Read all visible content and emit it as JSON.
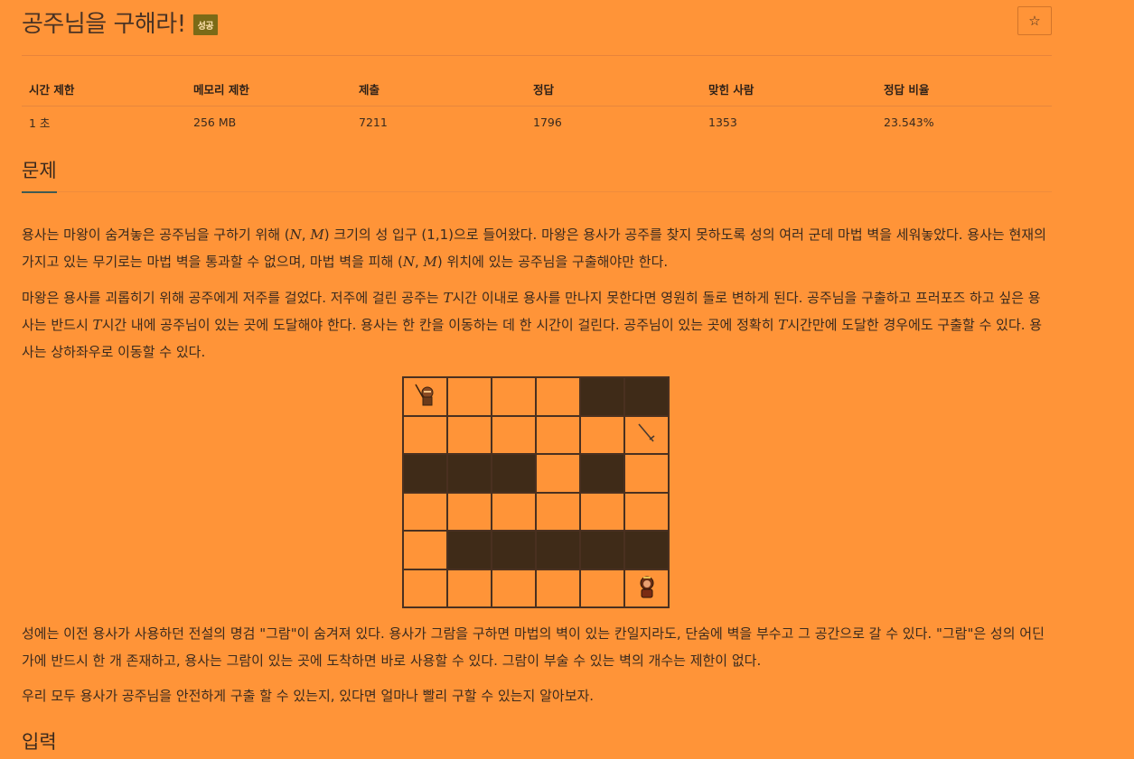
{
  "header": {
    "title": "공주님을 구해라!",
    "badge": "성공",
    "star_icon": "☆"
  },
  "stats": {
    "headers": [
      "시간 제한",
      "메모리 제한",
      "제출",
      "정답",
      "맞힌 사람",
      "정답 비율"
    ],
    "values": [
      "1 초",
      "256 MB",
      "7211",
      "1796",
      "1353",
      "23.543%"
    ]
  },
  "section": {
    "problem_title": "문제",
    "input_title": "입력"
  },
  "text": {
    "p1_a": "용사는 마왕이 숨겨놓은 공주님을 구하기 위해 (",
    "p1_n": "N",
    "p1_sep": ", ",
    "p1_m": "M",
    "p1_b": ") 크기의 성 입구 (1,1)으로 들어왔다. 마왕은 용사가 공주를 찾지 못하도록 성의 여러 군데 마법 벽을 세워놓았다. 용사는 현재의 가지고 있는 무기로는 마법 벽을 통과할 수 없으며, 마법 벽을 피해 (",
    "p1_n2": "N",
    "p1_sep2": ", ",
    "p1_m2": "M",
    "p1_c": ") 위치에 있는 공주님을 구출해야만 한다.",
    "p2_a": "마왕은 용사를 괴롭히기 위해 공주에게 저주를 걸었다. 저주에 걸린 공주는 ",
    "p2_t": "T",
    "p2_b": "시간 이내로 용사를 만나지 못한다면 영원히 돌로 변하게 된다. 공주님을 구출하고 프러포즈 하고 싶은 용사는 반드시 ",
    "p2_t2": "T",
    "p2_c": "시간 내에 공주님이 있는 곳에 도달해야 한다. 용사는 한 칸을 이동하는 데 한 시간이 걸린다. 공주님이 있는 곳에 정확히 ",
    "p2_t3": "T",
    "p2_d": "시간만에 도달한 경우에도 구출할 수 있다. 용사는 상하좌우로 이동할 수 있다.",
    "p4": "성에는 이전 용사가 사용하던 전설의 명검 \"그람\"이 숨겨져 있다. 용사가 그람을 구하면 마법의 벽이 있는 칸일지라도, 단숨에 벽을 부수고 그 공간으로 갈 수 있다. \"그람\"은 성의 어딘가에 반드시 한 개 존재하고, 용사는 그람이 있는 곳에 도착하면 바로 사용할 수 있다. 그람이 부술 수 있는 벽의 개수는 제한이 없다.",
    "p5": "우리 모두 용사가 공주님을 안전하게 구출 할 수 있는지, 있다면 얼마나 빨리 구할 수 있는지 알아보자."
  },
  "grid": {
    "rows": [
      [
        "hero",
        "empty",
        "empty",
        "empty",
        "wall",
        "wall"
      ],
      [
        "empty",
        "empty",
        "empty",
        "empty",
        "empty",
        "sword"
      ],
      [
        "wall",
        "wall",
        "wall",
        "empty",
        "wall",
        "empty"
      ],
      [
        "empty",
        "empty",
        "empty",
        "empty",
        "empty",
        "empty"
      ],
      [
        "empty",
        "wall",
        "wall",
        "wall",
        "wall",
        "wall"
      ],
      [
        "empty",
        "empty",
        "empty",
        "empty",
        "empty",
        "princess"
      ]
    ],
    "colors": {
      "wall": "#3f2b18",
      "line": "#4a3020"
    }
  }
}
